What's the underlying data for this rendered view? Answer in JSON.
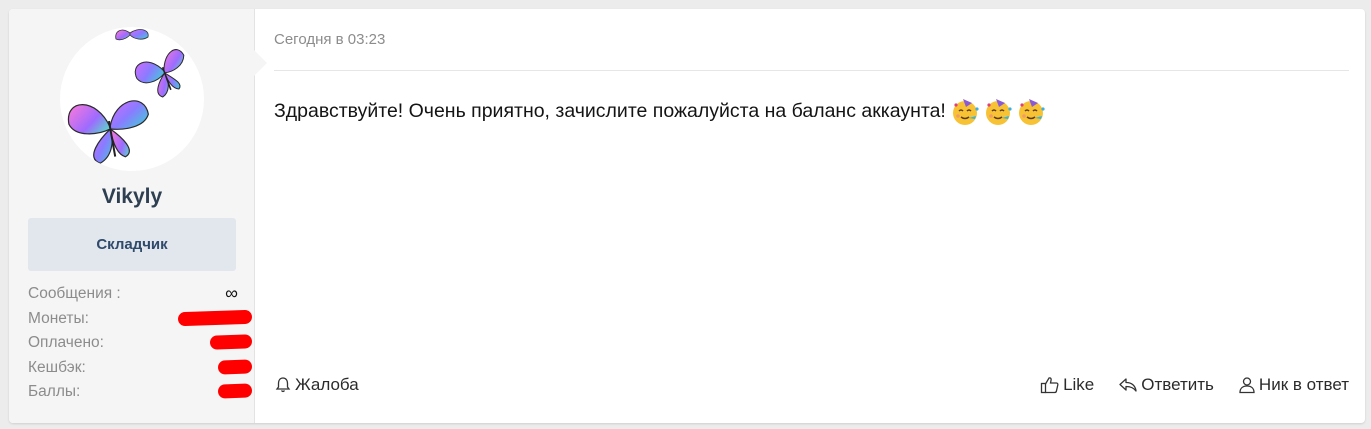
{
  "user": {
    "username": "Vikyly",
    "title": "Складчик",
    "stats": [
      {
        "label": "Сообщения :",
        "value": "∞"
      },
      {
        "label": "Монеты:",
        "value": ""
      },
      {
        "label": "Оплачено:",
        "value": ""
      },
      {
        "label": "Кешбэк:",
        "value": ""
      },
      {
        "label": "Баллы:",
        "value": ""
      }
    ]
  },
  "post": {
    "date": "Сегодня в 03:23",
    "message": "Здравствуйте! Очень приятно, зачислите пожалуйста на баланс аккаунта!",
    "emojis": [
      "partying-face-emoji",
      "partying-face-emoji",
      "partying-face-emoji"
    ]
  },
  "actions": {
    "report": "Жалоба",
    "like": "Like",
    "reply": "Ответить",
    "nick": "Ник в ответ"
  },
  "colors": {
    "username": "#2f3f52",
    "title_bg": "#e2e7ed",
    "title_text": "#2f4a6b",
    "redaction": "#ff0000"
  }
}
